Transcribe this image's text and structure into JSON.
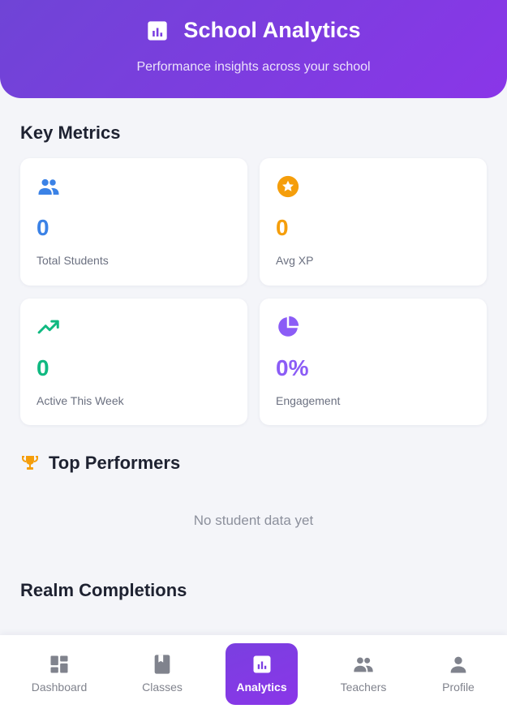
{
  "header": {
    "title": "School Analytics",
    "subtitle": "Performance insights across your school",
    "icon": "bar-chart-icon"
  },
  "key_metrics": {
    "title": "Key Metrics",
    "cards": [
      {
        "icon": "people-icon",
        "value": "0",
        "label": "Total Students",
        "color": "#3b82e6"
      },
      {
        "icon": "star-badge-icon",
        "value": "0",
        "label": "Avg XP",
        "color": "#f59e0b"
      },
      {
        "icon": "trending-up-icon",
        "value": "0",
        "label": "Active This Week",
        "color": "#10b981"
      },
      {
        "icon": "pie-chart-icon",
        "value": "0%",
        "label": "Engagement",
        "color": "#8b5cf6"
      }
    ]
  },
  "top_performers": {
    "title": "Top Performers",
    "icon": "trophy-icon",
    "icon_color": "#f59e0b",
    "empty_text": "No student data yet"
  },
  "realm_completions": {
    "title": "Realm Completions"
  },
  "nav": {
    "items": [
      {
        "label": "Dashboard",
        "icon": "dashboard-icon",
        "active": false
      },
      {
        "label": "Classes",
        "icon": "book-icon",
        "active": false
      },
      {
        "label": "Analytics",
        "icon": "analytics-icon",
        "active": true
      },
      {
        "label": "Teachers",
        "icon": "people-icon",
        "active": false
      },
      {
        "label": "Profile",
        "icon": "person-icon",
        "active": false
      }
    ]
  }
}
